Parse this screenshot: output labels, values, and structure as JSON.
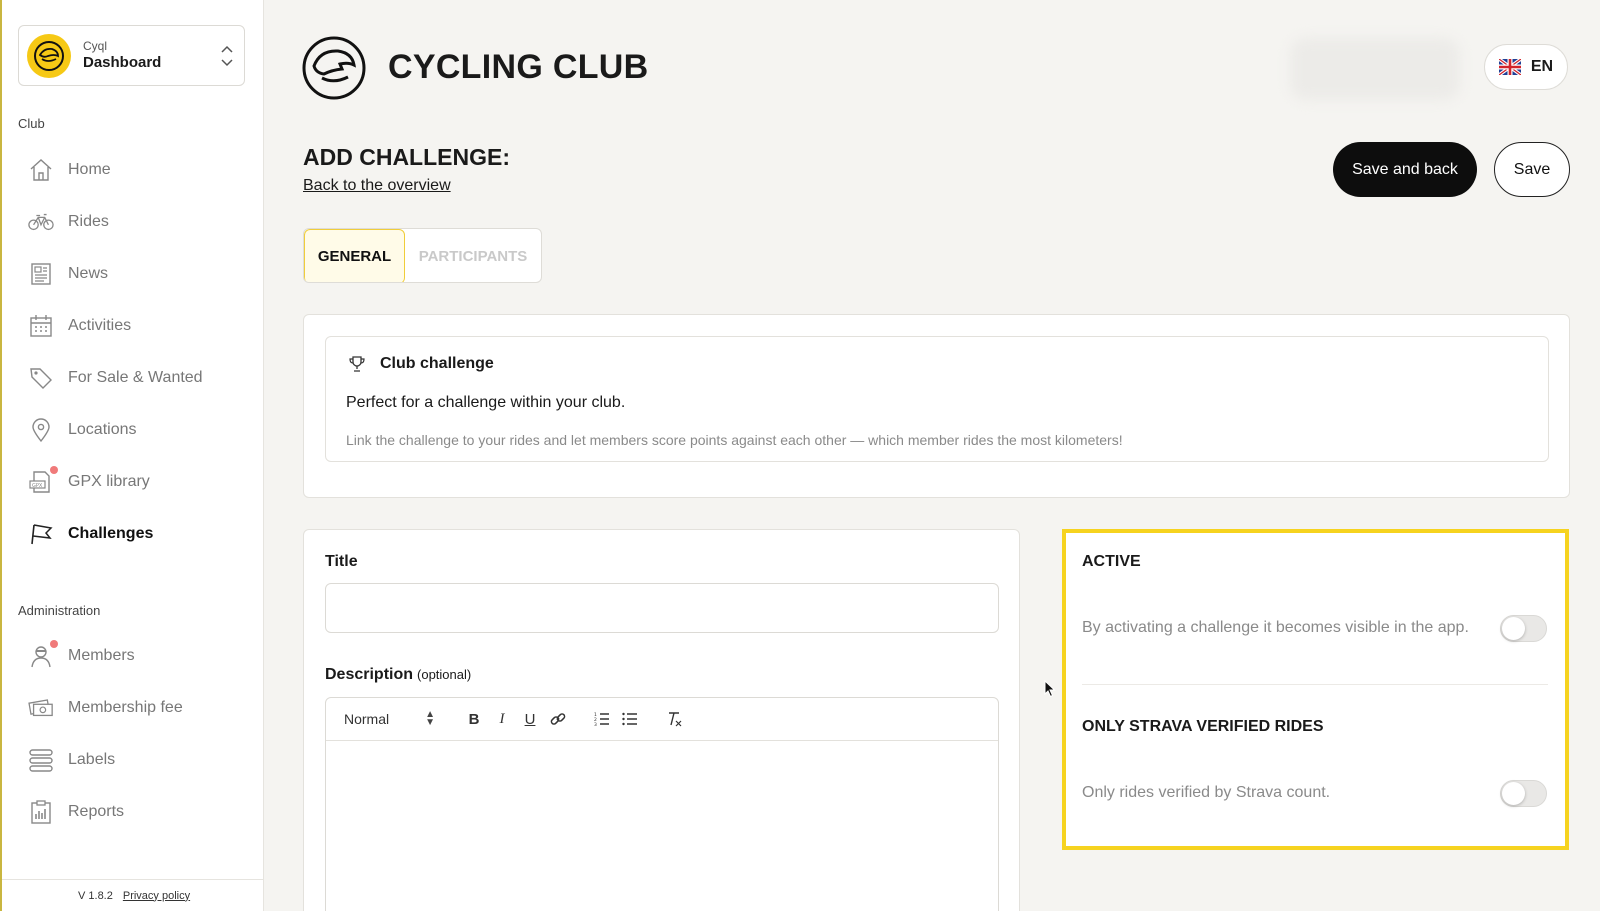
{
  "app": {
    "org_small": "Cyql",
    "org_name": "Dashboard",
    "version": "V 1.8.2",
    "privacy_label": "Privacy policy"
  },
  "sidebar": {
    "section_club": "Club",
    "club_items": [
      {
        "label": "Home",
        "icon": "home-icon"
      },
      {
        "label": "Rides",
        "icon": "bicycle-icon"
      },
      {
        "label": "News",
        "icon": "newspaper-icon"
      },
      {
        "label": "Activities",
        "icon": "calendar-icon"
      },
      {
        "label": "For Sale & Wanted",
        "icon": "tag-icon"
      },
      {
        "label": "Locations",
        "icon": "location-pin-icon"
      },
      {
        "label": "GPX library",
        "icon": "gpx-file-icon"
      },
      {
        "label": "Challenges",
        "icon": "flag-icon"
      }
    ],
    "section_admin": "Administration",
    "admin_items": [
      {
        "label": "Members",
        "icon": "member-icon"
      },
      {
        "label": "Membership fee",
        "icon": "money-icon"
      },
      {
        "label": "Labels",
        "icon": "labels-icon"
      },
      {
        "label": "Reports",
        "icon": "clipboard-icon"
      }
    ]
  },
  "header": {
    "brand": "CYCLING CLUB",
    "language": "EN",
    "flag_icon": "uk-flag-icon"
  },
  "page": {
    "title": "ADD CHALLENGE:",
    "back_link": "Back to the overview",
    "save_and_back": "Save and back",
    "save": "Save"
  },
  "tabs": [
    {
      "label": "GENERAL",
      "active": true
    },
    {
      "label": "PARTICIPANTS",
      "active": false
    }
  ],
  "challenge_type": {
    "title": "Club challenge",
    "description": "Perfect for a challenge within your club.",
    "detail": "Link the challenge to your rides and let members score points against each other — which member rides the most kilometers!"
  },
  "form": {
    "title_label": "Title",
    "title_value": "",
    "description_label": "Description",
    "description_optional": "(optional)",
    "format_select": "Normal"
  },
  "settings": {
    "active_heading": "ACTIVE",
    "active_desc": "By activating a challenge it becomes visible in the app.",
    "active_on": false,
    "strava_heading": "ONLY STRAVA VERIFIED RIDES",
    "strava_desc": "Only rides verified by Strava count.",
    "strava_on": false
  },
  "colors": {
    "accent": "#f6d31f",
    "primary_button": "#0d0d0d",
    "notification_dot": "#f07a7a"
  }
}
